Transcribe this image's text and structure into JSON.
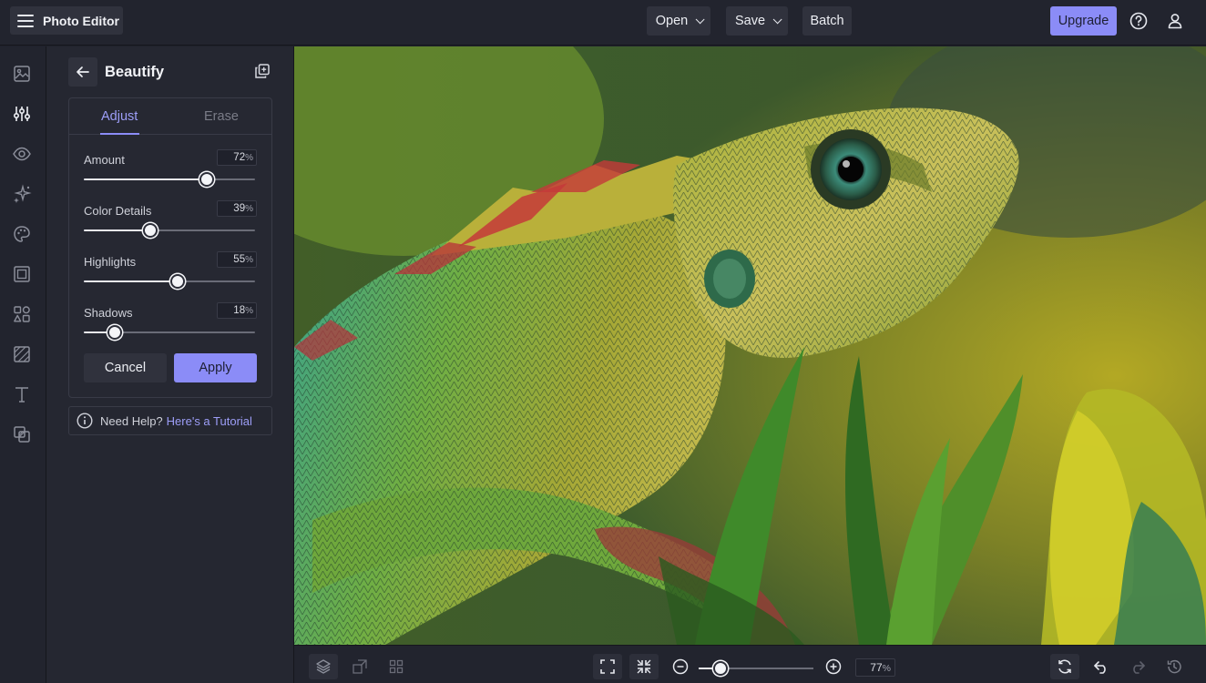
{
  "app": {
    "title": "Photo Editor",
    "menu_icon": "hamburger-menu-icon"
  },
  "toolbar": {
    "open_label": "Open",
    "save_label": "Save",
    "batch_label": "Batch",
    "upgrade_label": "Upgrade",
    "help_icon": "help-circle-icon",
    "account_icon": "user-icon"
  },
  "rail": {
    "items": [
      {
        "name": "image-icon",
        "active": false
      },
      {
        "name": "adjust-sliders-icon",
        "active": true
      },
      {
        "name": "eye-icon",
        "active": false
      },
      {
        "name": "sparkle-effects-icon",
        "active": false
      },
      {
        "name": "palette-icon",
        "active": false
      },
      {
        "name": "frame-icon",
        "active": false
      },
      {
        "name": "shapes-icon",
        "active": false
      },
      {
        "name": "texture-icon",
        "active": false
      },
      {
        "name": "text-icon",
        "active": false
      },
      {
        "name": "overlay-icon",
        "active": false
      }
    ]
  },
  "panel": {
    "title": "Beautify",
    "tabs": [
      {
        "label": "Adjust",
        "active": true
      },
      {
        "label": "Erase",
        "active": false
      }
    ],
    "sliders": [
      {
        "label": "Amount",
        "value": 72,
        "unit": "%"
      },
      {
        "label": "Color Details",
        "value": 39,
        "unit": "%"
      },
      {
        "label": "Highlights",
        "value": 55,
        "unit": "%"
      },
      {
        "label": "Shadows",
        "value": 18,
        "unit": "%"
      }
    ],
    "cancel_label": "Cancel",
    "apply_label": "Apply",
    "help_text": "Need Help?",
    "help_link": "Here's a Tutorial"
  },
  "bottombar": {
    "zoom_value": 77,
    "zoom_unit": "%",
    "zoom_slider_fraction": 0.19
  },
  "colors": {
    "accent": "#8b8cf7",
    "bg": "#1f212b",
    "panel": "#252731"
  }
}
